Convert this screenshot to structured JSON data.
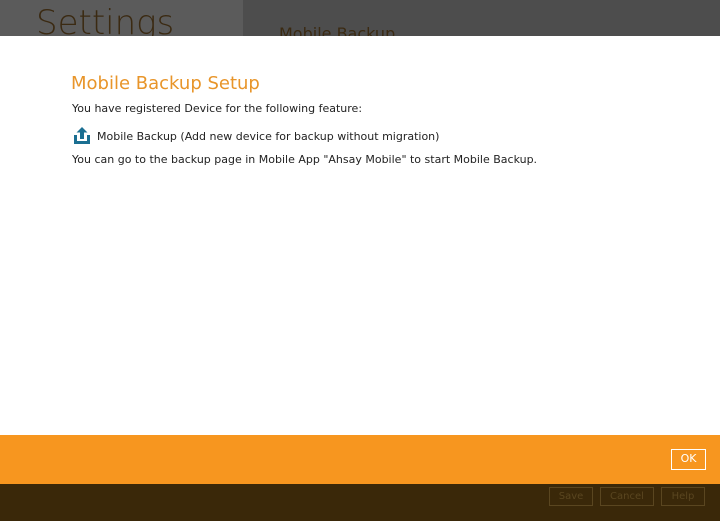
{
  "background": {
    "settings_title": "Settings",
    "section_title": "Mobile Backup",
    "buttons": {
      "save": "Save",
      "cancel": "Cancel",
      "help": "Help"
    }
  },
  "dialog": {
    "title": "Mobile Backup Setup",
    "intro": "You have registered Device for the following feature:",
    "feature": {
      "icon": "upload-icon",
      "label": "Mobile Backup (Add new device for backup without migration)"
    },
    "instructions": "You can go to the backup page in Mobile App \"Ahsay Mobile\" to start Mobile Backup.",
    "ok_label": "OK"
  },
  "colors": {
    "accent_orange": "#f7961f",
    "title_orange": "#e8952a",
    "icon_blue": "#1b6f92",
    "dark_brown": "#3a2809"
  }
}
